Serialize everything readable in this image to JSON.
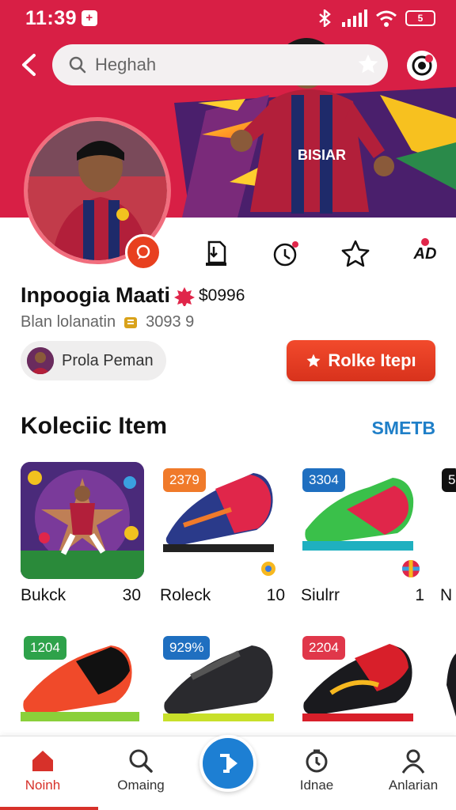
{
  "status": {
    "time": "11:39",
    "notification_glyph": "+",
    "battery": "5"
  },
  "topbar": {
    "search_placeholder": "Heghah"
  },
  "profile": {
    "name": "Inpoogia Maati",
    "amount": "$0996",
    "subtitle": "Blan lolanatin",
    "sub_count": "3093 9",
    "chip_label": "Prola Peman",
    "primary_button": "Rolke Itepı",
    "action_ad_label": "AD"
  },
  "section": {
    "title": "Koleciic Item",
    "link": "SMETB"
  },
  "items": [
    {
      "badge": "",
      "title": "Bukck",
      "count": "30"
    },
    {
      "badge": "2379",
      "badge_color": "#f07a2a",
      "title": "Roleck",
      "count": "10"
    },
    {
      "badge": "3304",
      "badge_color": "#1f6fc0",
      "title": "Siulrr",
      "count": "1"
    },
    {
      "badge": "5",
      "badge_color": "#111111",
      "title": "N",
      "count": ""
    },
    {
      "badge": "1204",
      "badge_color": "#2ea24a",
      "title": "",
      "count": ""
    },
    {
      "badge": "929%",
      "badge_color": "#1f6fc0",
      "title": "",
      "count": ""
    },
    {
      "badge": "2204",
      "badge_color": "#e0374a",
      "title": "",
      "count": ""
    }
  ],
  "nav": [
    {
      "label": "Noinh",
      "icon": "home-icon",
      "active": true
    },
    {
      "label": "Omaing",
      "icon": "search-icon",
      "active": false
    },
    {
      "label": "Idnae",
      "icon": "timer-icon",
      "active": false
    },
    {
      "label": "Anlarian",
      "icon": "user-icon",
      "active": false
    }
  ],
  "colors": {
    "brand": "#d81f45",
    "accent": "#e8401f",
    "link": "#1f7fc8",
    "fab": "#1d7fd3"
  }
}
